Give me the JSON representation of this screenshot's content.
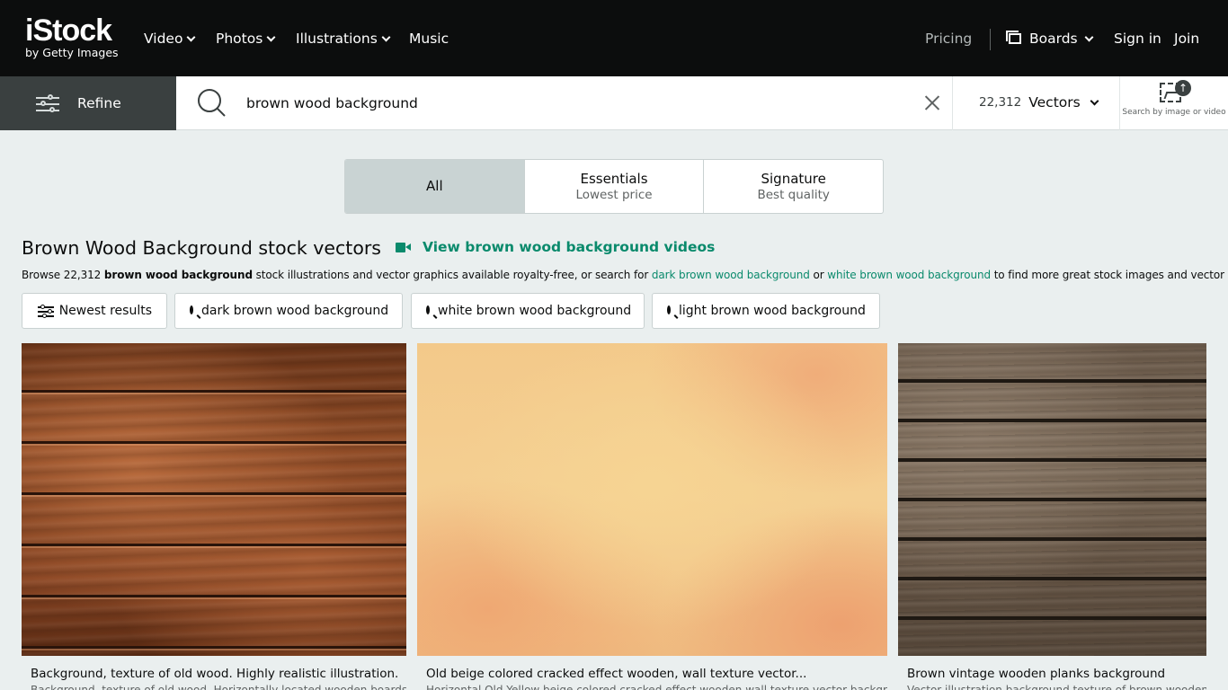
{
  "brand": {
    "name": "iStock",
    "tagline": "by Getty Images"
  },
  "nav": {
    "items": [
      {
        "label": "Video",
        "has_menu": true
      },
      {
        "label": "Photos",
        "has_menu": true
      },
      {
        "label": "Illustrations",
        "has_menu": true
      },
      {
        "label": "Music",
        "has_menu": false
      }
    ],
    "pricing": "Pricing",
    "boards": "Boards",
    "signin": "Sign in",
    "join": "Join"
  },
  "search": {
    "refine_label": "Refine",
    "query": "brown wood background",
    "result_count": "22,312",
    "asset_type": "Vectors",
    "image_search_label": "Search by image or video"
  },
  "tabs": [
    {
      "title": "All",
      "subtitle": "",
      "active": true
    },
    {
      "title": "Essentials",
      "subtitle": "Lowest price",
      "active": false
    },
    {
      "title": "Signature",
      "subtitle": "Best quality",
      "active": false
    }
  ],
  "page": {
    "heading": "Brown Wood Background stock vectors",
    "video_link": "View brown wood background videos",
    "browse": {
      "prefix": "Browse 22,312 ",
      "term": "brown wood background",
      "middle": " stock illustrations and vector graphics available royalty-free, or search for ",
      "link1": "dark brown wood background",
      "or": " or ",
      "link2": "white brown wood background",
      "suffix": " to find more great stock images and vector art."
    }
  },
  "chips": [
    {
      "label": "Newest results",
      "icon": "sliders-icon"
    },
    {
      "label": "dark brown wood background",
      "icon": "search-icon"
    },
    {
      "label": "white brown wood background",
      "icon": "search-icon"
    },
    {
      "label": "light brown wood background",
      "icon": "search-icon"
    }
  ],
  "results": [
    {
      "caption": "Background, texture of old wood. Highly realistic illustration.",
      "description": "Background, texture of old wood. Horizontally located wooden boards"
    },
    {
      "caption": "Old beige colored cracked effect wooden, wall texture vector...",
      "description": "Horizontal Old Yellow beige colored cracked effect wooden wall texture vector background"
    },
    {
      "caption": "Brown vintage wooden planks background",
      "description": "Vector illustration background texture of brown wooden planks"
    }
  ],
  "colors": {
    "accent": "#0a8a6c",
    "nav_bg": "#0c0d0d",
    "refine_bg": "#3a4040",
    "page_bg": "#eaefef"
  }
}
